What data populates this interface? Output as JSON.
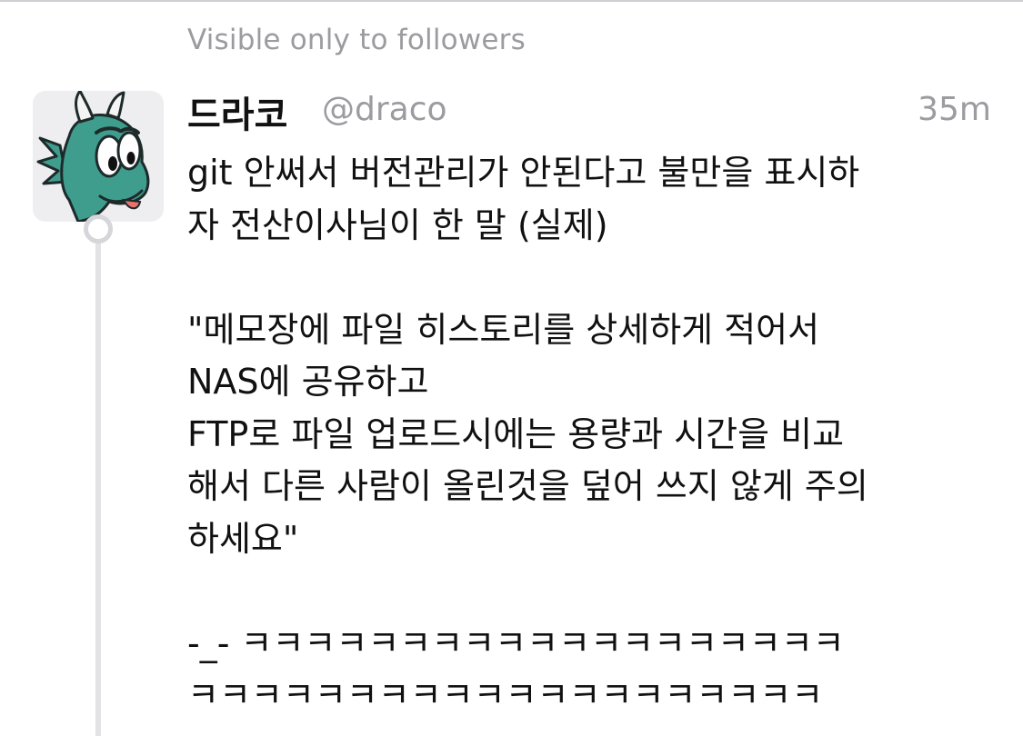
{
  "visibility": "Visible only to followers",
  "post": {
    "display_name": "드라코",
    "handle": "@draco",
    "timestamp": "35m",
    "lines": [
      "git 안써서 버전관리가 안된다고 불만을 표시하",
      "자 전산이사님이 한 말 (실제)",
      "",
      "\"메모장에 파일 히스토리를 상세하게 적어서",
      "NAS에 공유하고",
      "FTP로 파일 업로드시에는 용량과 시간을 비교",
      "해서 다른 사람이 올린것을 덮어 쓰지 않게 주의",
      "하세요\"",
      "",
      "-_- ㅋㅋㅋㅋㅋㅋㅋㅋㅋㅋㅋㅋㅋㅋㅋㅋㅋㅋㅋ",
      "ㅋㅋㅋㅋㅋㅋㅋㅋㅋㅋㅋㅋㅋㅋㅋㅋㅋㅋㅋㅋ"
    ]
  },
  "colors": {
    "muted_text": "#9b9ba0",
    "body_text": "#111111",
    "avatar_bg": "#eeeef1",
    "dragon_green": "#3f9d8e"
  },
  "icons": {
    "avatar": "dragon-avatar-icon"
  }
}
